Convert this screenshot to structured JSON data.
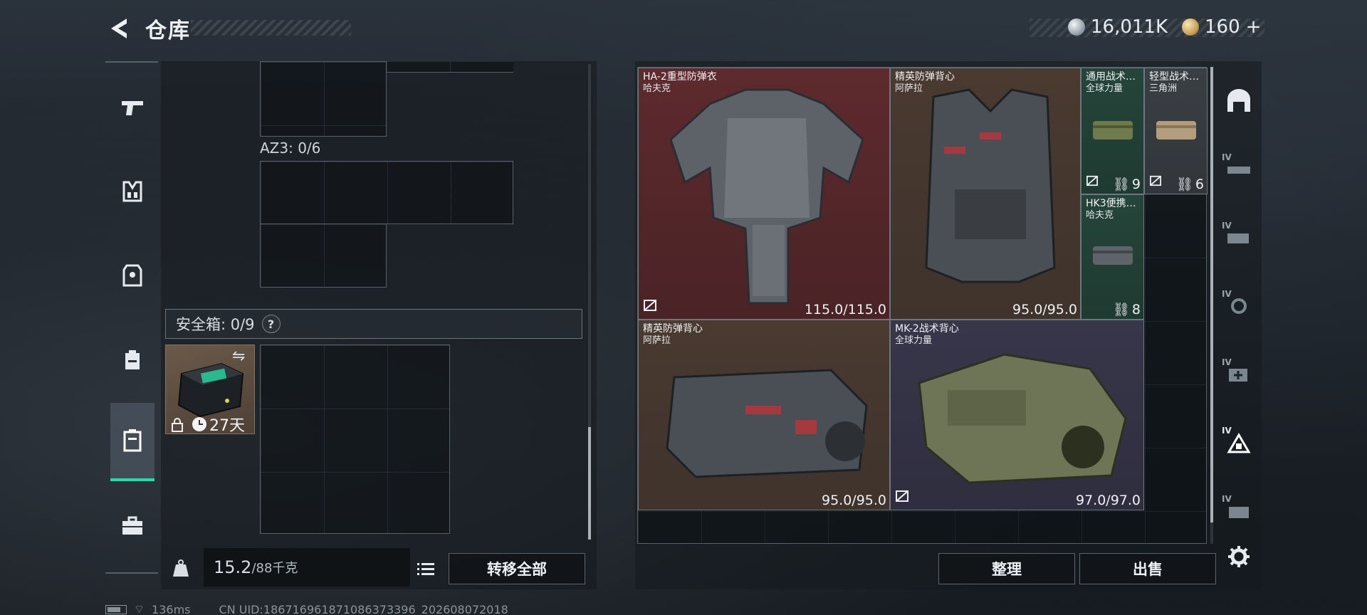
{
  "header": {
    "title": "仓库",
    "currency_main": "16,011K",
    "currency_premium": "160",
    "currency_add": "+"
  },
  "left": {
    "az_label": "AZ3: 0/6",
    "safe_label": "安全箱: 0/9",
    "help": "?",
    "safe_item_days": "27天",
    "weight_value": "15.2",
    "weight_capacity": "/88千克",
    "transfer_all": "转移全部"
  },
  "stash": {
    "items": [
      {
        "name": "HA-2重型防弹衣",
        "brand": "哈夫克",
        "durability": "115.0/115.0"
      },
      {
        "name": "精英防弹背心",
        "brand": "阿萨拉",
        "durability": "95.0/95.0"
      },
      {
        "name": "通用战术…",
        "brand": "全球力量",
        "count": "9"
      },
      {
        "name": "轻型战术…",
        "brand": "三角洲",
        "count": "6"
      },
      {
        "name": "HK3便携…",
        "brand": "哈夫克",
        "count": "8"
      },
      {
        "name": "精英防弹背心",
        "brand": "阿萨拉",
        "durability": "95.0/95.0"
      },
      {
        "name": "MK-2战术背心",
        "brand": "全球力量",
        "durability": "97.0/97.0"
      }
    ],
    "sort_label": "整理",
    "sell_label": "出售"
  },
  "status": {
    "ping": "136ms",
    "uid": "CN UID:186716961871086373396_202608072018"
  },
  "colors": {
    "accent": "#2fd6ad",
    "heavy_armor_bg": "#5e2a2e",
    "brown_bg": "#4a3a30",
    "green_bg": "#25453a",
    "purple_bg": "#38364a",
    "gray_bg": "#3a3f44"
  }
}
